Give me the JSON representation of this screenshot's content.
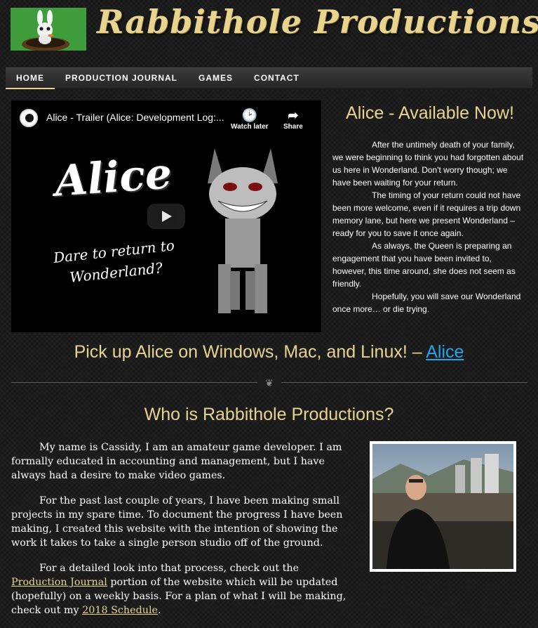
{
  "header": {
    "site_title": "Rabbithole Productions",
    "logo_icon": "rabbit-logo-icon"
  },
  "nav": {
    "items": [
      {
        "label": "HOME",
        "active": true
      },
      {
        "label": "PRODUCTION JOURNAL",
        "active": false
      },
      {
        "label": "GAMES",
        "active": false
      },
      {
        "label": "CONTACT",
        "active": false
      }
    ]
  },
  "video": {
    "title": "Alice - Trailer (Alice: Development Log:...",
    "watch_later": "Watch later",
    "share": "Share",
    "big_title": "Alice",
    "tagline": "Dare to return to Wonderland?"
  },
  "alice_section": {
    "heading": "Alice - Available Now!",
    "paragraphs": [
      "After the untimely death of your family, we were beginning to think you had forgotten about us here in Wonderland. Don't worry though; we have been waiting for your return.",
      "The timing of your return could not have been more welcome, even if it requires a trip down memory lane, but here we present Wonderland – ready for you to save it once again.",
      "As always, the Queen is preparing an engagement that you have been invited to, however, this time around, she does not seem as friendly.",
      "Hopefully, you will save our Wonderland once more… or die trying."
    ]
  },
  "pickup": {
    "text": "Pick up Alice on Windows, Mac, and Linux!  – ",
    "link_label": "Alice"
  },
  "who": {
    "heading": "Who is Rabbithole Productions?",
    "p1": "My name is Cassidy, I am an amateur game developer. I am formally educated in accounting and management, but I have always had a desire to make video games.",
    "p2": "For the past last couple of years, I have been making small projects in my spare time. To document the progress I have been making, I created this website with the intention of showing the work it takes to take a single person studio off of the ground.",
    "p3_before": "For a detailed look into that process, check out the ",
    "p3_link1": "Production Journal",
    "p3_middle": " portion of the website which will be updated (hopefully) on a weekly basis. For a plan of what I will be making, check out my ",
    "p3_link2": "2018 Schedule",
    "p3_after": "."
  },
  "colors": {
    "accent": "#e8d48e",
    "link": "#1fa6e6",
    "background": "#1c1c1c"
  }
}
